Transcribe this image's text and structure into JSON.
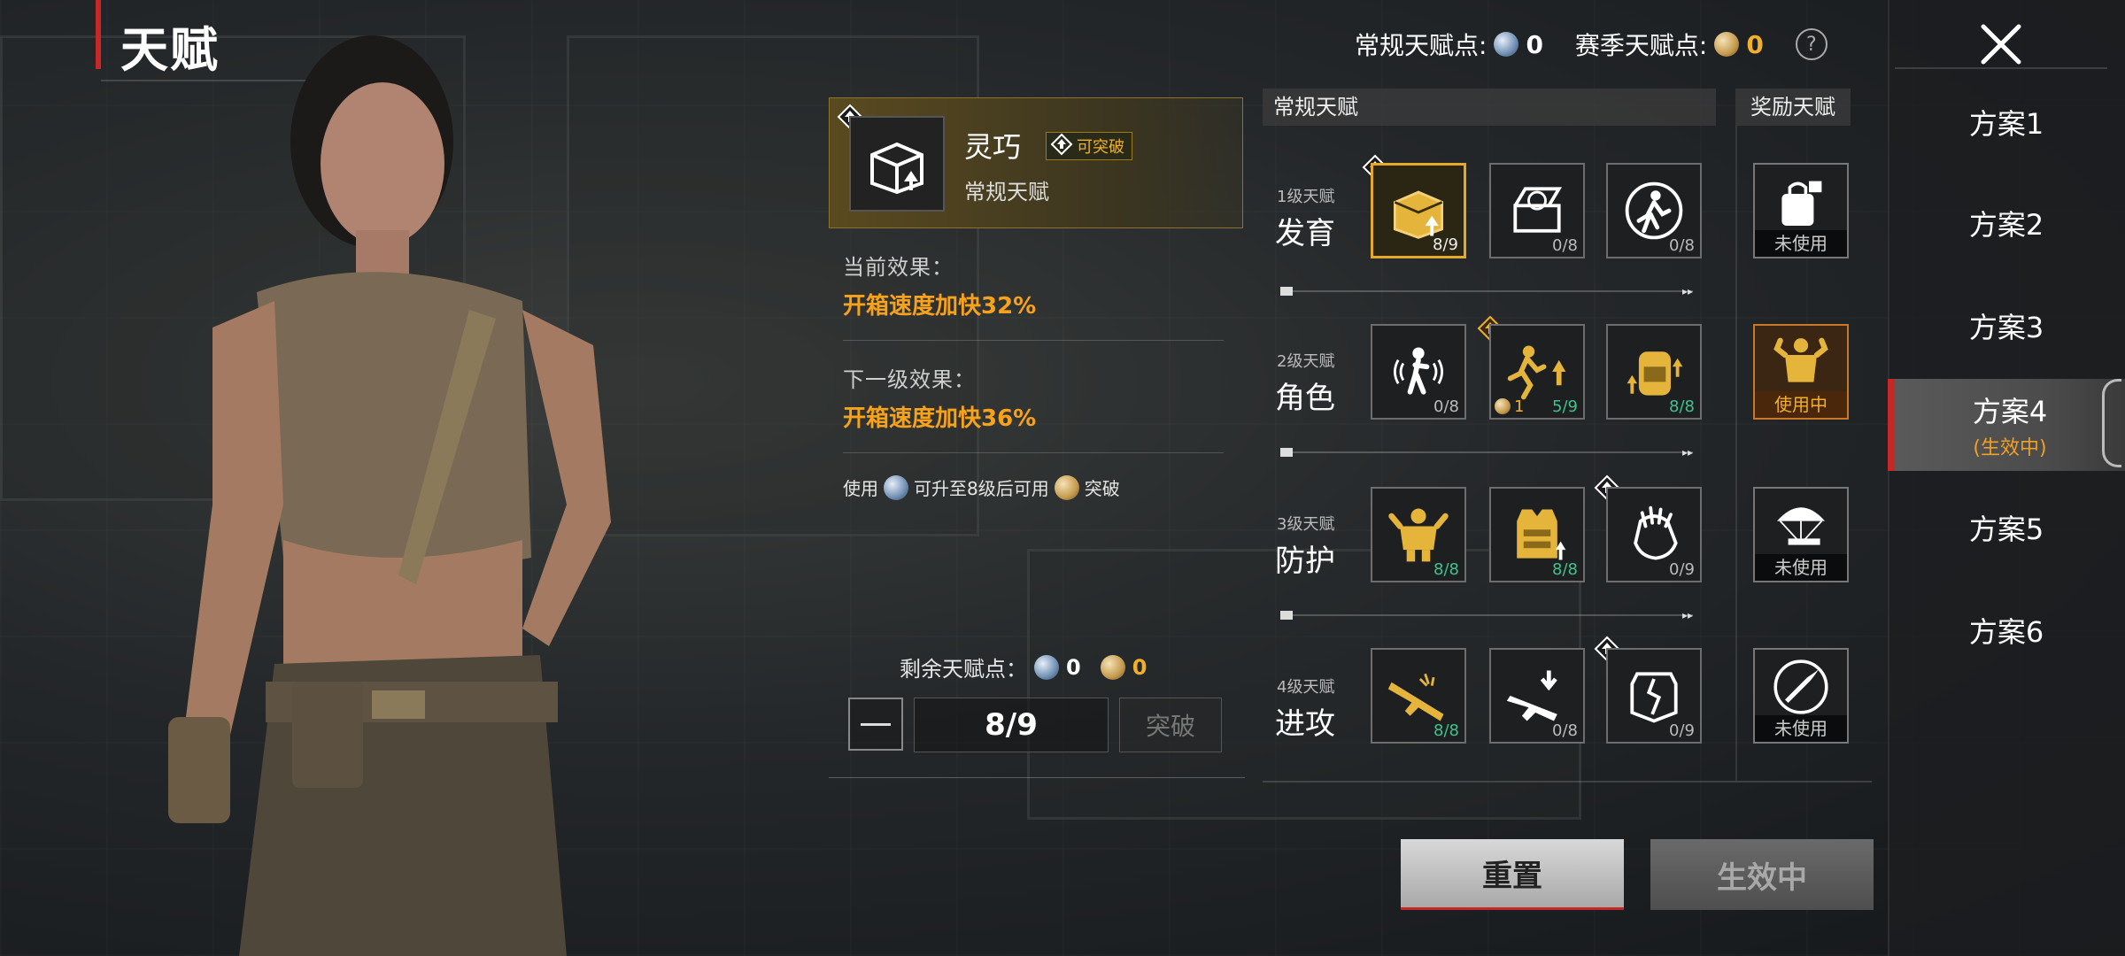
{
  "page_title": "天赋",
  "header": {
    "normal_points_label": "常规天赋点:",
    "normal_points_value": "0",
    "season_points_label": "赛季天赋点:",
    "season_points_value": "0",
    "help_icon": "question-circle-icon"
  },
  "detail": {
    "name": "灵巧",
    "tag": "可突破",
    "type": "常规天赋",
    "current_effect_label": "当前效果：",
    "current_effect_value": "开箱速度加快32%",
    "next_effect_label": "下一级效果：",
    "next_effect_value": "开箱速度加快36%",
    "usage_prefix": "使用",
    "usage_middle": "可升至8级后可用",
    "usage_suffix": "突破",
    "remaining_label": "剩余天赋点：",
    "remaining_normal": "0",
    "remaining_season": "0",
    "level_value": "8/9",
    "break_button": "突破"
  },
  "grid": {
    "normal_header": "常规天赋",
    "reward_header": "奖励天赋",
    "rows": [
      {
        "level": "1级天赋",
        "name": "发育",
        "talents": [
          {
            "icon": "crate-open-icon",
            "count": "8/9",
            "state": "selected"
          },
          {
            "icon": "medkit-crate-icon",
            "count": "0/8",
            "state": "empty"
          },
          {
            "icon": "running-soldier-icon",
            "count": "0/8",
            "state": "empty"
          }
        ]
      },
      {
        "level": "2级天赋",
        "name": "角色",
        "talents": [
          {
            "icon": "soldier-signal-icon",
            "count": "0/8",
            "state": "empty"
          },
          {
            "icon": "sprint-speed-icon",
            "count": "5/9",
            "season_count": "1",
            "state": "partial"
          },
          {
            "icon": "backpack-up-icon",
            "count": "8/8",
            "state": "full"
          }
        ]
      },
      {
        "level": "3级天赋",
        "name": "防护",
        "talents": [
          {
            "icon": "strongman-icon",
            "count": "8/8",
            "state": "full"
          },
          {
            "icon": "vest-armor-icon",
            "count": "8/8",
            "state": "full"
          },
          {
            "icon": "glove-hand-icon",
            "count": "0/9",
            "state": "empty"
          }
        ]
      },
      {
        "level": "4级天赋",
        "name": "进攻",
        "talents": [
          {
            "icon": "rifle-burst-icon",
            "count": "8/8",
            "state": "full"
          },
          {
            "icon": "rifle-reload-icon",
            "count": "0/8",
            "state": "empty"
          },
          {
            "icon": "broken-shield-icon",
            "count": "0/9",
            "state": "empty"
          }
        ]
      }
    ],
    "rewards": [
      {
        "icon": "bag-lock-icon",
        "caption": "未使用"
      },
      {
        "icon": "flexing-man-icon",
        "caption": "使用中"
      },
      {
        "icon": "parachute-gun-icon",
        "caption": "未使用"
      },
      {
        "icon": "bullet-icon",
        "caption": "未使用"
      }
    ]
  },
  "buttons": {
    "reset": "重置",
    "active": "生效中"
  },
  "plans": {
    "items": [
      "方案1",
      "方案2",
      "方案3",
      "方案4",
      "方案5",
      "方案6"
    ],
    "active_sub": "(生效中)"
  },
  "colors": {
    "accent_gold": "#f0b02a",
    "accent_red": "#c62828",
    "count_green": "#3fc38e",
    "effect_orange": "#f7a21b"
  }
}
